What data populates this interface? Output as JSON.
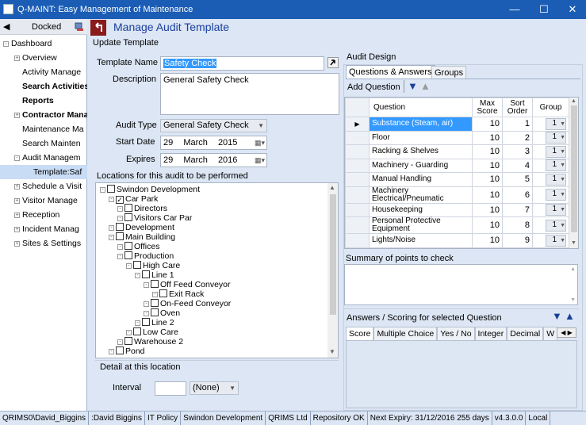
{
  "window": {
    "title": "Q-MAINT: Easy Management of Maintenance",
    "minimize": "—",
    "maximize": "☐",
    "close": "✕"
  },
  "nav": {
    "back": "◀",
    "header": "Docked",
    "items": [
      {
        "label": "Dashboard",
        "toggle": "-",
        "bold": false,
        "indent": 0
      },
      {
        "label": "Overview",
        "toggle": "+",
        "bold": false,
        "indent": 1
      },
      {
        "label": "Activity Manage",
        "toggle": "",
        "bold": false,
        "indent": 1
      },
      {
        "label": "Search Activities",
        "toggle": "",
        "bold": true,
        "indent": 1
      },
      {
        "label": "Reports",
        "toggle": "",
        "bold": true,
        "indent": 1
      },
      {
        "label": "Contractor Mana",
        "toggle": "+",
        "bold": true,
        "indent": 1
      },
      {
        "label": "Maintenance Ma",
        "toggle": "",
        "bold": false,
        "indent": 1
      },
      {
        "label": "Search Mainten",
        "toggle": "",
        "bold": false,
        "indent": 1
      },
      {
        "label": "Audit Managem",
        "toggle": "-",
        "bold": false,
        "indent": 1
      },
      {
        "label": "Template:Saf",
        "toggle": "",
        "bold": false,
        "indent": 2
      },
      {
        "label": "Schedule a Visit",
        "toggle": "+",
        "bold": false,
        "indent": 1
      },
      {
        "label": "Visitor Manage",
        "toggle": "+",
        "bold": false,
        "indent": 1
      },
      {
        "label": "Reception",
        "toggle": "+",
        "bold": false,
        "indent": 1
      },
      {
        "label": "Incident Manag",
        "toggle": "+",
        "bold": false,
        "indent": 1
      },
      {
        "label": "Sites & Settings",
        "toggle": "+",
        "bold": false,
        "indent": 1
      }
    ]
  },
  "page": {
    "title": "Manage Audit Template",
    "subtitle": "Update Template"
  },
  "form": {
    "template_name_label": "Template Name",
    "template_name": "Safety Check",
    "description_label": "Description",
    "description": "General Safety Check",
    "audit_type_label": "Audit Type",
    "audit_type": "General Safety Check",
    "start_date_label": "Start Date",
    "start_day": "29",
    "start_month": "March",
    "start_year": "2015",
    "expires_label": "Expires",
    "exp_day": "29",
    "exp_month": "March",
    "exp_year": "2016",
    "locations_label": "Locations for this audit to be performed",
    "detail_label": "Detail at this location",
    "interval_label": "Interval",
    "interval_value": "",
    "interval_unit": "(None)"
  },
  "tree": [
    {
      "label": "Swindon Development",
      "level": 0,
      "checked": false
    },
    {
      "label": "Car Park",
      "level": 1,
      "checked": true
    },
    {
      "label": "Directors",
      "level": 2,
      "checked": false
    },
    {
      "label": "Visitors Car Par",
      "level": 2,
      "checked": false
    },
    {
      "label": "Development",
      "level": 1,
      "checked": false
    },
    {
      "label": "Main Building",
      "level": 1,
      "checked": false
    },
    {
      "label": "Offices",
      "level": 2,
      "checked": false
    },
    {
      "label": "Production",
      "level": 2,
      "checked": false
    },
    {
      "label": "High Care",
      "level": 3,
      "checked": false
    },
    {
      "label": "Line 1",
      "level": 4,
      "checked": false
    },
    {
      "label": "Off Feed Conveyor",
      "level": 5,
      "checked": false
    },
    {
      "label": "Exit Rack",
      "level": 6,
      "checked": false
    },
    {
      "label": "On-Feed Conveyor",
      "level": 5,
      "checked": false
    },
    {
      "label": "Oven",
      "level": 5,
      "checked": false
    },
    {
      "label": "Line 2",
      "level": 4,
      "checked": false
    },
    {
      "label": "Low Care",
      "level": 3,
      "checked": false
    },
    {
      "label": "Warehouse 2",
      "level": 2,
      "checked": false
    },
    {
      "label": "Pond",
      "level": 1,
      "checked": false
    }
  ],
  "design": {
    "title": "Audit Design",
    "tabs": [
      "Questions & Answers",
      "Groups"
    ],
    "add_question": "Add Question",
    "columns": [
      "Question",
      "Max Score",
      "Sort Order",
      "Group"
    ],
    "rows": [
      {
        "q": "Substance (Steam, air)",
        "max": "10",
        "sort": "1",
        "group": "1"
      },
      {
        "q": "Floor",
        "max": "10",
        "sort": "2",
        "group": "1"
      },
      {
        "q": "Racking & Shelves",
        "max": "10",
        "sort": "3",
        "group": "1"
      },
      {
        "q": "Machinery - Guarding",
        "max": "10",
        "sort": "4",
        "group": "1"
      },
      {
        "q": "Manual Handling",
        "max": "10",
        "sort": "5",
        "group": "1"
      },
      {
        "q": "Machinery Electrical/Pneumatic",
        "max": "10",
        "sort": "6",
        "group": "1"
      },
      {
        "q": "Housekeeping",
        "max": "10",
        "sort": "7",
        "group": "1"
      },
      {
        "q": "Personal Protective Equipment",
        "max": "10",
        "sort": "8",
        "group": "1"
      },
      {
        "q": "Lights/Noise",
        "max": "10",
        "sort": "9",
        "group": "1"
      }
    ],
    "summary_label": "Summary of points to check",
    "answers_label": "Answers / Scoring for selected Question",
    "answer_tabs": [
      "Score",
      "Multiple Choice",
      "Yes / No",
      "Integer",
      "Decimal",
      "W"
    ]
  },
  "status": [
    "QRIMS0\\David_Biggins",
    ":David Biggins",
    "IT Policy",
    "Swindon Development",
    "QRIMS Ltd",
    "Repository OK",
    "Next Expiry: 31/12/2016   255 days",
    "v4.3.0.0",
    "Local"
  ],
  "colors": {
    "title_bar": "#1b5db5",
    "selection": "#3399ff",
    "accent": "#1a3f9c"
  }
}
